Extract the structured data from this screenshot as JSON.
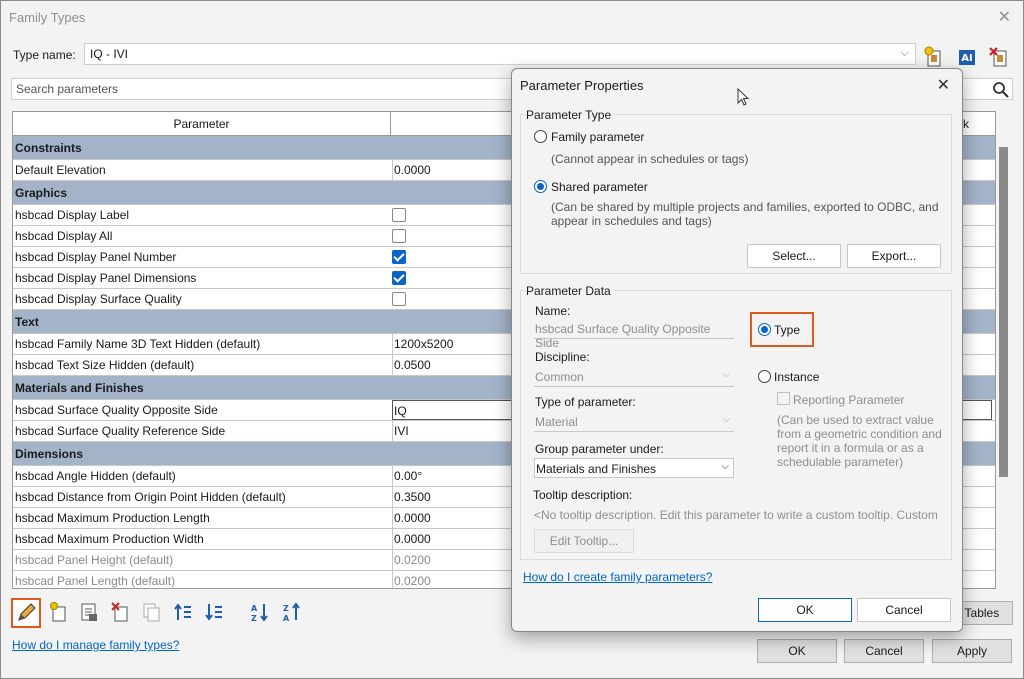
{
  "main": {
    "title": "Family Types",
    "type_name_label": "Type name:",
    "type_name_value": "IQ - IVI",
    "search_placeholder": "Search parameters",
    "col_parameter": "Parameter",
    "col_k": "k",
    "rows": [
      {
        "kind": "group",
        "name": "Constraints"
      },
      {
        "kind": "value",
        "name": "Default Elevation",
        "value": "0.0000"
      },
      {
        "kind": "group",
        "name": "Graphics"
      },
      {
        "kind": "check",
        "name": "hsbcad Display Label",
        "checked": false
      },
      {
        "kind": "check",
        "name": "hsbcad Display All",
        "checked": false
      },
      {
        "kind": "check",
        "name": "hsbcad Display Panel Number",
        "checked": true
      },
      {
        "kind": "check",
        "name": "hsbcad Display Panel Dimensions",
        "checked": true
      },
      {
        "kind": "check",
        "name": "hsbcad Display Surface Quality",
        "checked": false
      },
      {
        "kind": "group",
        "name": "Text"
      },
      {
        "kind": "value",
        "name": "hsbcad Family Name 3D Text Hidden (default)",
        "value": "1200x5200"
      },
      {
        "kind": "value",
        "name": "hsbcad Text Size Hidden (default)",
        "value": "0.0500"
      },
      {
        "kind": "group",
        "name": "Materials and Finishes"
      },
      {
        "kind": "value",
        "name": "hsbcad Surface Quality Opposite Side",
        "value": "IQ",
        "active": true
      },
      {
        "kind": "value",
        "name": "hsbcad Surface Quality Reference Side",
        "value": "IVI"
      },
      {
        "kind": "group",
        "name": "Dimensions"
      },
      {
        "kind": "value",
        "name": "hsbcad Angle Hidden (default)",
        "value": "0.00°"
      },
      {
        "kind": "value",
        "name": "hsbcad Distance from Origin Point Hidden (default)",
        "value": "0.3500"
      },
      {
        "kind": "value",
        "name": "hsbcad Maximum Production Length",
        "value": "0.0000"
      },
      {
        "kind": "value",
        "name": "hsbcad Maximum Production Width",
        "value": "0.0000"
      },
      {
        "kind": "value",
        "name": "hsbcad Panel Height (default)",
        "value": "0.0200",
        "dim": true
      },
      {
        "kind": "value",
        "name": "hsbcad Panel Length (default)",
        "value": "0.0200",
        "dim": true
      }
    ],
    "manage_link": "How do I manage family types?",
    "lookup_tables_btn": "p Tables",
    "ok_btn": "OK",
    "cancel_btn": "Cancel",
    "apply_btn": "Apply"
  },
  "dialog": {
    "title": "Parameter Properties",
    "param_type_group": "Parameter Type",
    "family_param_label": "Family parameter",
    "family_param_note": "(Cannot appear in schedules or tags)",
    "shared_param_label": "Shared parameter",
    "shared_param_note_1": "(Can be shared by multiple projects and families, exported to ODBC, and",
    "shared_param_note_2": "appear in schedules and tags)",
    "select_btn": "Select...",
    "export_btn": "Export...",
    "param_data_group": "Parameter Data",
    "name_label": "Name:",
    "name_value": "hsbcad Surface Quality Opposite Side",
    "type_radio": "Type",
    "instance_radio": "Instance",
    "reporting_label": "Reporting Parameter",
    "reporting_note_1": "(Can be used to extract value",
    "reporting_note_2": "from a geometric condition and",
    "reporting_note_3": "report it in a formula or as a",
    "reporting_note_4": "schedulable parameter)",
    "discipline_label": "Discipline:",
    "discipline_value": "Common",
    "type_of_param_label": "Type of parameter:",
    "type_of_param_value": "Material",
    "group_under_label": "Group parameter under:",
    "group_under_value": "Materials and Finishes",
    "tooltip_label": "Tooltip description:",
    "tooltip_value": "<No tooltip description. Edit this parameter to write a custom tooltip. Custom",
    "edit_tooltip_btn": "Edit Tooltip...",
    "help_link": "How do I create family parameters?",
    "ok_btn": "OK",
    "cancel_btn": "Cancel"
  },
  "colors": {
    "group_row": "#a3b4c9",
    "accent": "#0a64c8",
    "highlight": "#e05a1e"
  }
}
